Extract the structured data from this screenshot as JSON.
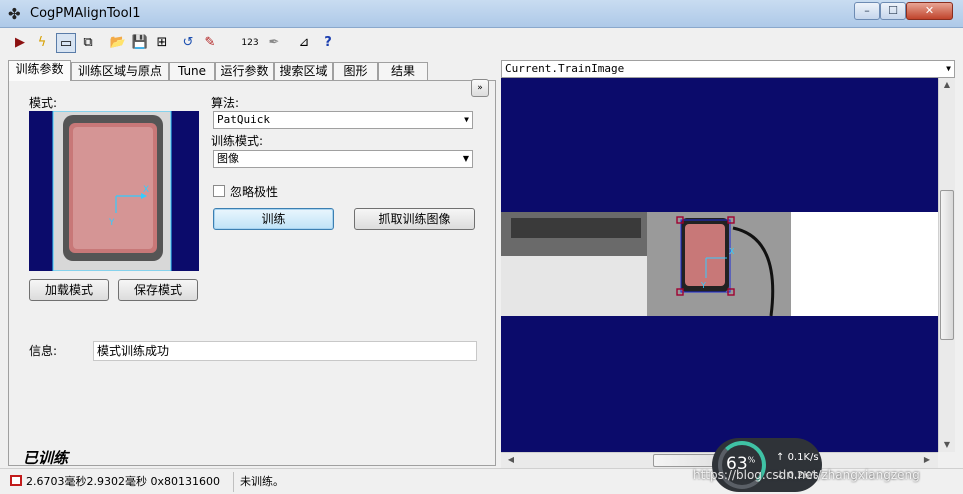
{
  "window": {
    "title": "CogPMAlignTool1",
    "min": "0",
    "max": "1",
    "close": "r"
  },
  "tabs": [
    "训练参数",
    "训练区域与原点",
    "Tune",
    "运行参数",
    "搜索区域",
    "图形",
    "结果"
  ],
  "train_params": {
    "model_label": "模式:",
    "algorithm_label": "算法:",
    "algorithm_value": "PatQuick",
    "train_mode_label": "训练模式:",
    "train_mode_value": "图像",
    "ignore_polarity_label": "忽略极性",
    "train_button": "训练",
    "grab_train_image_button": "抓取训练图像",
    "load_model_button": "加载模式",
    "save_model_button": "保存模式",
    "info_label": "信息:",
    "info_value": "模式训练成功",
    "trained_status": "已训练"
  },
  "display": {
    "selected_image": "Current.TrainImage"
  },
  "status_bar": {
    "timing": "2.6703毫秒2.9302毫秒 0x80131600",
    "message": "未训练。"
  },
  "overlay": {
    "cpu_percent": "63",
    "cpu_unit": "%",
    "upload": "0.1K/s",
    "download": "0.2K/s"
  },
  "watermark": "https://blog.csdn.net/zhangxiangzeng",
  "colors": {
    "image_background": "#0b0b6b",
    "model_region": "#c87878",
    "graphics_cyan": "#33ccff"
  }
}
